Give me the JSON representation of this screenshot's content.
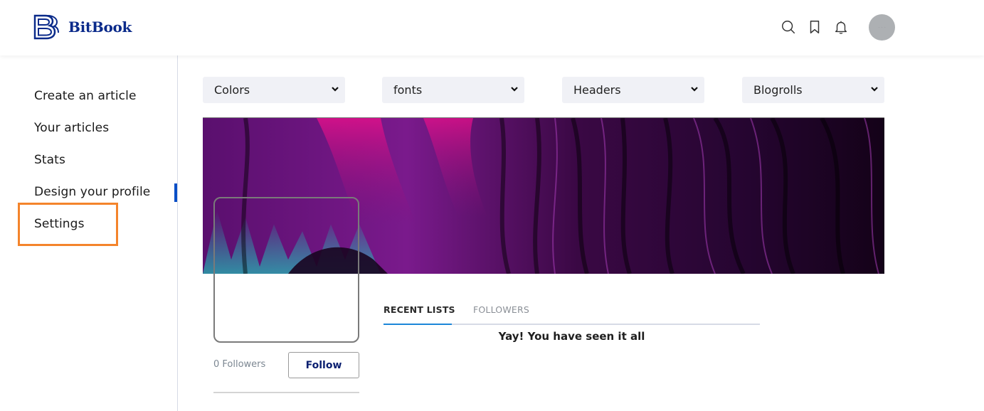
{
  "header": {
    "brand": "BitBook",
    "brand_color": "#0a2a8a",
    "icons": [
      "search-icon",
      "bookmark-icon",
      "bell-icon"
    ],
    "avatar_label": "- - -"
  },
  "sidebar": {
    "items": [
      {
        "label": "Create an article"
      },
      {
        "label": "Your articles"
      },
      {
        "label": "Stats"
      },
      {
        "label": "Design your profile",
        "active": true
      },
      {
        "label": "Settings",
        "highlighted": true
      }
    ],
    "active_color": "#0a4fc6",
    "highlight_color": "#f4842b"
  },
  "design": {
    "selects": [
      {
        "selected": "Colors"
      },
      {
        "selected": "fonts"
      },
      {
        "selected": "Headers"
      },
      {
        "selected": "Blogrolls"
      }
    ]
  },
  "profile": {
    "followers_text": "0 Followers",
    "follow_button": "Follow"
  },
  "tabs": {
    "items": [
      {
        "label": "RECENT LISTS",
        "active": true
      },
      {
        "label": "FOLLOWERS",
        "active": false
      }
    ],
    "accent_color": "#1c86d9"
  },
  "feed": {
    "empty_message": "Yay! You have seen it all"
  }
}
